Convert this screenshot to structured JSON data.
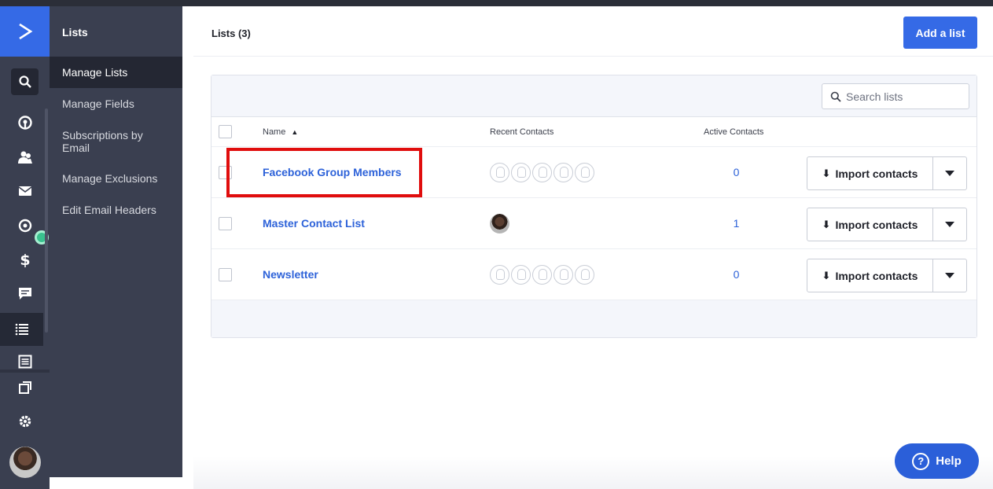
{
  "sidebar": {
    "title": "Lists",
    "items": [
      {
        "label": "Manage Lists",
        "active": true
      },
      {
        "label": "Manage Fields"
      },
      {
        "label": "Subscriptions by Email"
      },
      {
        "label": "Manage Exclusions"
      },
      {
        "label": "Edit Email Headers"
      }
    ]
  },
  "rail": {
    "icons": [
      "logo-chevron-icon",
      "search-icon",
      "reports-icon",
      "contacts-icon",
      "email-icon",
      "automations-icon",
      "deals-icon",
      "conversations-icon",
      "lists-icon",
      "pages-icon",
      "apps-icon",
      "settings-icon",
      "user-avatar"
    ]
  },
  "header": {
    "title": "Lists (3)",
    "add_button": "Add a list"
  },
  "search": {
    "placeholder": "Search lists"
  },
  "table": {
    "columns": {
      "name": "Name",
      "recent": "Recent Contacts",
      "active": "Active Contacts"
    },
    "sort_indicator": "▲",
    "rows": [
      {
        "name": "Facebook Group Members",
        "active_contacts": "0",
        "recent": "empty"
      },
      {
        "name": "Master Contact List",
        "active_contacts": "1",
        "recent": "photo"
      },
      {
        "name": "Newsletter",
        "active_contacts": "0",
        "recent": "empty"
      }
    ],
    "import_label": "Import contacts"
  },
  "help": {
    "label": "Help",
    "icon": "?"
  },
  "colors": {
    "accent": "#356ae6",
    "highlight": "#e00d0d",
    "sidebar": "#3a3f50"
  }
}
